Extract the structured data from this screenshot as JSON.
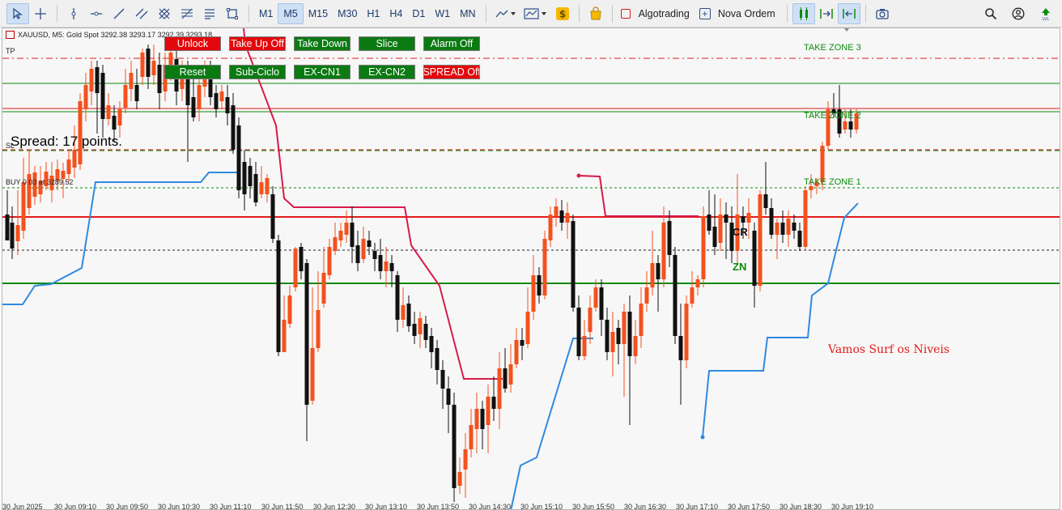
{
  "toolbar": {
    "timeframes": [
      "M1",
      "M5",
      "M15",
      "M30",
      "H1",
      "H4",
      "D1",
      "W1",
      "MN"
    ],
    "active_timeframe": "M5",
    "algotrading_label": "Algotrading",
    "new_order_label": "Nova Ordem"
  },
  "chart": {
    "header_text": "XAUUSD, M5:  Gold Spot  3292.38 3293.17 3292.39 3293.18",
    "tp_label": "TP",
    "sl_label": "SL",
    "buy_label": "BUY 0.03 at 3289.52",
    "spread_text": "Spread: 17 points.",
    "take_zone_3": "TAKE ZONE 3",
    "take_zone_2": "TAKE ZONE 2",
    "take_zone_1": "TAKE ZONE 1",
    "cr_label": "CR",
    "zn_label": "ZN",
    "annotation": "Vamos Surf os Niveis",
    "time_labels": [
      "30 Jun 2025",
      "30 Jun 09:10",
      "30 Jun 09:50",
      "30 Jun 10:30",
      "30 Jun 11:10",
      "30 Jun 11:50",
      "30 Jun 12:30",
      "30 Jun 13:10",
      "30 Jun 13:50",
      "30 Jun 14:30",
      "30 Jun 15:10",
      "30 Jun 15:50",
      "30 Jun 16:30",
      "30 Jun 17:10",
      "30 Jun 17:50",
      "30 Jun 18:30",
      "30 Jun 19:10"
    ]
  },
  "buttons": {
    "unlock": "Unlock",
    "take_up_off": "Take Up Off",
    "take_down": "Take Down",
    "slice": "Slice",
    "alarm_off": "Alarm Off",
    "reset": "Reset",
    "sub_ciclo": "Sub-Ciclo",
    "ex_cn1": "EX-CN1",
    "ex_cn2": "EX-CN2",
    "spread_off": "SPREAD Off"
  },
  "colors": {
    "bull": "#f4511e",
    "bear": "#111111",
    "ma_blue": "#2f8ae0",
    "ma_red": "#d81b4a",
    "level_red": "#e31b1b",
    "level_green": "#0b8a0b"
  }
}
